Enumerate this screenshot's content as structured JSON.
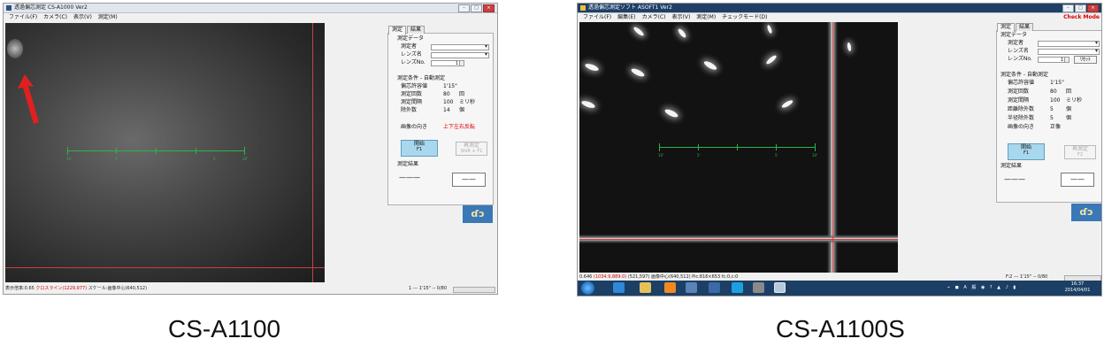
{
  "left": {
    "window_title": "透過偏芯測定 CS-A1000 Ver2",
    "menu": [
      "ファイル(F)",
      "カメラ(C)",
      "表示(V)",
      "測定(M)"
    ],
    "tabs": [
      "測定",
      "結果"
    ],
    "section_measure_data": "測定データ",
    "field_measurer": "測定者",
    "field_lens_name": "レンズ名",
    "field_lens_no": "レンズNo.",
    "lens_no_value": "1",
    "section_conditions": "測定条件 - 自動測定",
    "rows": [
      {
        "label": "偏芯許容値",
        "value": "1'15\"",
        "unit": ""
      },
      {
        "label": "測定回数",
        "value": "80",
        "unit": "回"
      },
      {
        "label": "測定間隔",
        "value": "100",
        "unit": "ミリ秒"
      },
      {
        "label": "除外数",
        "value": "14",
        "unit": "個"
      }
    ],
    "image_orientation_label": "画像の向き",
    "image_orientation_value": "上下左右反転",
    "start_label": "開始",
    "start_key": "F1",
    "remeasure_label": "再測定",
    "remeasure_key": "Shift + F1",
    "result_label": "測定結果",
    "result_value": "———",
    "result_box": "——",
    "logo_text": "ɗɔ",
    "scale_labels": [
      "10'",
      "5'",
      "5'",
      "10'"
    ],
    "status_left": "表示倍率:0.65",
    "status_red": "クロスライン(1229,977)",
    "status_mid": "スケール:画像中心(640,512)",
    "status_right": "1 --- 1'15\" -- 0/80"
  },
  "right": {
    "window_title": "透過偏芯測定ソフト ASOFT1 Ver2",
    "menu": [
      "ファイル(F)",
      "編集(E)",
      "カメラ(C)",
      "表示(V)",
      "測定(M)",
      "チェックモード(D)"
    ],
    "check_mode": "Check Mode",
    "tabs": [
      "測定",
      "結果"
    ],
    "section_measure_data": "測定データ",
    "field_measurer": "測定者",
    "field_lens_name": "レンズ名",
    "field_lens_no": "レンズNo.",
    "lens_no_value": "1",
    "reset_button": "ﾘｾｯﾄ",
    "section_conditions": "測定条件 - 自動測定",
    "rows": [
      {
        "label": "偏芯許容値",
        "value": "1'15\"",
        "unit": ""
      },
      {
        "label": "測定回数",
        "value": "80",
        "unit": "回"
      },
      {
        "label": "測定間隔",
        "value": "100",
        "unit": "ミリ秒"
      },
      {
        "label": "距離除外数",
        "value": "5",
        "unit": "個"
      },
      {
        "label": "半径除外数",
        "value": "5",
        "unit": "個"
      },
      {
        "label": "画像の向き",
        "value": "正像",
        "unit": ""
      }
    ],
    "start_label": "開始",
    "start_key": "F1",
    "remeasure_label": "再測定",
    "remeasure_key": "F2",
    "result_label": "測定結果",
    "result_value": "———",
    "result_box": "——",
    "logo_text": "ɗɔ",
    "scale_labels": [
      "10'",
      "5'",
      "5'",
      "10'"
    ],
    "status_left": "0.646",
    "status_red": "(1034.9,889.0)",
    "status_mid": "(521,597)  画像中心(640,512)  Pic:816×653  fc:0,c:0",
    "status_right": "F:2 --- 1'15\" -- 0/80",
    "clock_time": "16:37",
    "clock_date": "2014/04/01"
  },
  "captions": {
    "left": "CS-A1100",
    "right": "CS-A1100S"
  }
}
